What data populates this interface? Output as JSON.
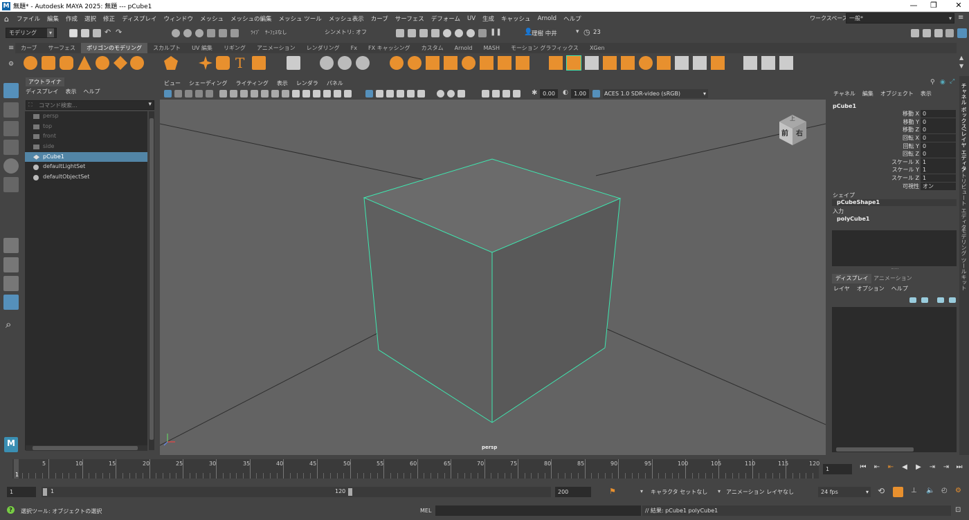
{
  "window": {
    "title": "無題* - Autodesk MAYA 2025: 無題   ---   pCube1",
    "minimize": "—",
    "maximize": "❐",
    "close": "✕"
  },
  "menubar": {
    "items": [
      "ファイル",
      "編集",
      "作成",
      "選択",
      "修正",
      "ディスプレイ",
      "ウィンドウ",
      "メッシュ",
      "メッシュの編集",
      "メッシュ ツール",
      "メッシュ表示",
      "カーブ",
      "サーフェス",
      "デフォーム",
      "UV",
      "生成",
      "キャッシュ",
      "Arnold",
      "ヘルプ"
    ],
    "workspace_label": "ワークスペース:",
    "workspace_value": "一般*"
  },
  "statusline": {
    "mode": "モデリング",
    "live_label": "ﾗｲﾌﾞ",
    "live_value": "ｻｰﾌｪｽなし",
    "symmetry": "シンメトリ: オフ",
    "user": "理樹 中井",
    "credits": "23"
  },
  "shelf": {
    "tabs": [
      "カーブ",
      "サーフェス",
      "ポリゴンのモデリング",
      "スカルプト",
      "UV 編集",
      "リギング",
      "アニメーション",
      "レンダリング",
      "Fx",
      "FX キャッシング",
      "カスタム",
      "Arnold",
      "MASH",
      "モーション グラフィックス",
      "XGen"
    ],
    "active_tab": "ポリゴンのモデリング",
    "accent": "#e8902e"
  },
  "outliner": {
    "tab": "アウトライナ",
    "menu": [
      "ディスプレイ",
      "表示",
      "ヘルプ"
    ],
    "search_placeholder": "コマンド検索...",
    "items": [
      {
        "label": "persp",
        "type": "camera",
        "dim": true
      },
      {
        "label": "top",
        "type": "camera",
        "dim": true
      },
      {
        "label": "front",
        "type": "camera",
        "dim": true
      },
      {
        "label": "side",
        "type": "camera",
        "dim": true
      },
      {
        "label": "pCube1",
        "type": "mesh",
        "selected": true
      },
      {
        "label": "defaultLightSet",
        "type": "set"
      },
      {
        "label": "defaultObjectSet",
        "type": "set"
      }
    ]
  },
  "viewport": {
    "menu": [
      "ビュー",
      "シェーディング",
      "ライティング",
      "表示",
      "レンダラ",
      "パネル"
    ],
    "exposure": "0.00",
    "gamma": "1.00",
    "color_space": "ACES 1.0 SDR-video (sRGB)",
    "camera_label": "persp",
    "viewcube_front": "前",
    "viewcube_right": "右",
    "viewcube_top": "上",
    "selection_color": "#3ee8b0"
  },
  "channelbox": {
    "menu": [
      "チャネル",
      "編集",
      "オブジェクト",
      "表示"
    ],
    "object": "pCube1",
    "channels": [
      {
        "label": "移動 X",
        "value": "0"
      },
      {
        "label": "移動 Y",
        "value": "0"
      },
      {
        "label": "移動 Z",
        "value": "0"
      },
      {
        "label": "回転 X",
        "value": "0"
      },
      {
        "label": "回転 Y",
        "value": "0"
      },
      {
        "label": "回転 Z",
        "value": "0"
      },
      {
        "label": "スケール X",
        "value": "1"
      },
      {
        "label": "スケール Y",
        "value": "1"
      },
      {
        "label": "スケール Z",
        "value": "1"
      },
      {
        "label": "可視性",
        "value": "オン"
      }
    ],
    "shape_header": "シェイプ",
    "shape_name": "pCubeShape1",
    "input_header": "入力",
    "input_name": "polyCube1",
    "layer_tabs": [
      "ディスプレイ",
      "アニメーション"
    ],
    "layer_menu": [
      "レイヤ",
      "オプション",
      "ヘルプ"
    ]
  },
  "side_tabs": [
    "チャネル ボックス/レイヤ エディタ",
    "アトリビュート エディタ",
    "モデリング ツールキット"
  ],
  "timeline": {
    "ticks": [
      "5",
      "10",
      "15",
      "20",
      "25",
      "30",
      "35",
      "40",
      "45",
      "50",
      "55",
      "60",
      "65",
      "70",
      "75",
      "80",
      "85",
      "90",
      "95",
      "100",
      "105",
      "110",
      "115",
      "120"
    ],
    "start_marker": "1",
    "current_frame": "1"
  },
  "range": {
    "start": "1",
    "inner_start": "1",
    "inner_end": "120",
    "end": "200",
    "character_set": "キャラクタ セットなし",
    "anim_layer": "アニメーション レイヤなし",
    "fps": "24 fps"
  },
  "commandline": {
    "help": "選択ツール: オブジェクトの選択",
    "lang": "MEL",
    "result": "// 結果: pCube1 polyCube1"
  }
}
